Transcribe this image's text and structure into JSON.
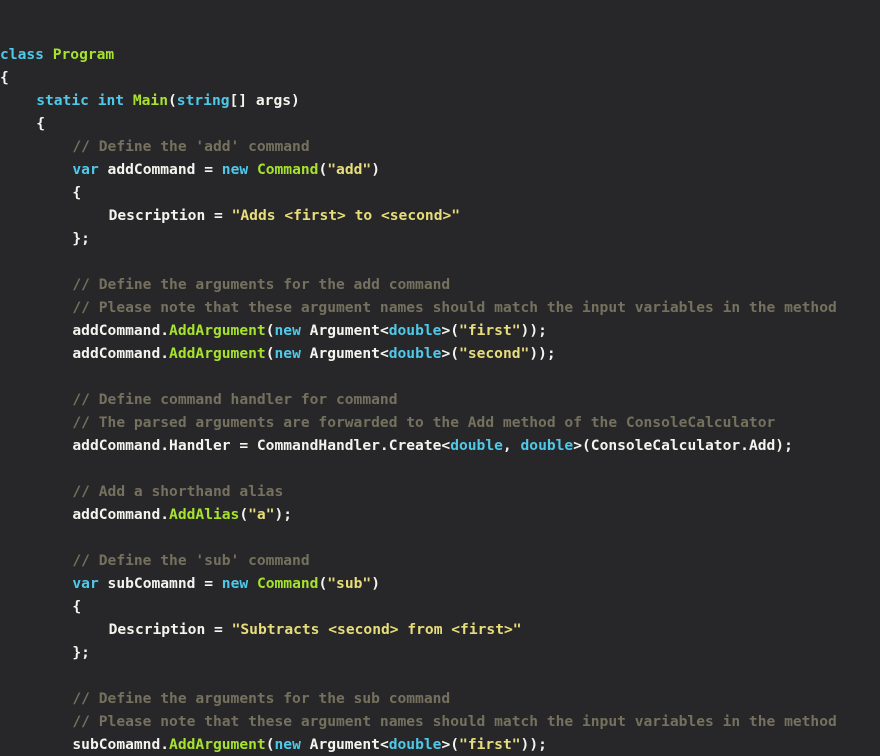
{
  "editor": {
    "language": "csharp",
    "background_color": "#272729",
    "theme_colors": {
      "plain": "#f4f4ef",
      "keyword": "#4fc9ea",
      "type": "#a6e22e",
      "string": "#e7dd7a",
      "comment": "#75715e"
    }
  },
  "code": {
    "lines": [
      {
        "id": 1,
        "indent": 0,
        "tokens": [
          {
            "t": "class ",
            "c": "kw"
          },
          {
            "t": "Program",
            "c": "typ"
          }
        ]
      },
      {
        "id": 2,
        "indent": 0,
        "tokens": [
          {
            "t": "{",
            "c": "pln"
          }
        ]
      },
      {
        "id": 3,
        "indent": 4,
        "tokens": [
          {
            "t": "static int ",
            "c": "kw"
          },
          {
            "t": "Main",
            "c": "typ"
          },
          {
            "t": "(",
            "c": "pln"
          },
          {
            "t": "string",
            "c": "kw"
          },
          {
            "t": "[] args)",
            "c": "pln"
          }
        ]
      },
      {
        "id": 4,
        "indent": 4,
        "tokens": [
          {
            "t": "{",
            "c": "pln"
          }
        ]
      },
      {
        "id": 5,
        "indent": 8,
        "tokens": [
          {
            "t": "// Define the 'add' command",
            "c": "cmt"
          }
        ]
      },
      {
        "id": 6,
        "indent": 8,
        "tokens": [
          {
            "t": "var ",
            "c": "kw"
          },
          {
            "t": "addCommand = ",
            "c": "pln"
          },
          {
            "t": "new ",
            "c": "kw"
          },
          {
            "t": "Command",
            "c": "typ"
          },
          {
            "t": "(",
            "c": "pln"
          },
          {
            "t": "\"add\"",
            "c": "str"
          },
          {
            "t": ")",
            "c": "pln"
          }
        ]
      },
      {
        "id": 7,
        "indent": 8,
        "tokens": [
          {
            "t": "{",
            "c": "pln"
          }
        ]
      },
      {
        "id": 8,
        "indent": 12,
        "tokens": [
          {
            "t": "Description = ",
            "c": "pln"
          },
          {
            "t": "\"Adds <first> to <second>\"",
            "c": "str"
          }
        ]
      },
      {
        "id": 9,
        "indent": 8,
        "tokens": [
          {
            "t": "};",
            "c": "pln"
          }
        ]
      },
      {
        "id": 10,
        "indent": 0,
        "tokens": []
      },
      {
        "id": 11,
        "indent": 8,
        "tokens": [
          {
            "t": "// Define the arguments for the add command",
            "c": "cmt"
          }
        ]
      },
      {
        "id": 12,
        "indent": 8,
        "tokens": [
          {
            "t": "// Please note that these argument names should match the input variables in the method",
            "c": "cmt"
          }
        ]
      },
      {
        "id": 13,
        "indent": 8,
        "tokens": [
          {
            "t": "addCommand.",
            "c": "pln"
          },
          {
            "t": "AddArgument",
            "c": "typ"
          },
          {
            "t": "(",
            "c": "pln"
          },
          {
            "t": "new ",
            "c": "kw"
          },
          {
            "t": "Argument<",
            "c": "pln"
          },
          {
            "t": "double",
            "c": "kw"
          },
          {
            "t": ">(",
            "c": "pln"
          },
          {
            "t": "\"first\"",
            "c": "str"
          },
          {
            "t": "));",
            "c": "pln"
          }
        ]
      },
      {
        "id": 14,
        "indent": 8,
        "tokens": [
          {
            "t": "addCommand.",
            "c": "pln"
          },
          {
            "t": "AddArgument",
            "c": "typ"
          },
          {
            "t": "(",
            "c": "pln"
          },
          {
            "t": "new ",
            "c": "kw"
          },
          {
            "t": "Argument<",
            "c": "pln"
          },
          {
            "t": "double",
            "c": "kw"
          },
          {
            "t": ">(",
            "c": "pln"
          },
          {
            "t": "\"second\"",
            "c": "str"
          },
          {
            "t": "));",
            "c": "pln"
          }
        ]
      },
      {
        "id": 15,
        "indent": 0,
        "tokens": []
      },
      {
        "id": 16,
        "indent": 8,
        "tokens": [
          {
            "t": "// Define command handler for command",
            "c": "cmt"
          }
        ]
      },
      {
        "id": 17,
        "indent": 8,
        "tokens": [
          {
            "t": "// The parsed arguments are forwarded to the Add method of the ConsoleCalculator",
            "c": "cmt"
          }
        ]
      },
      {
        "id": 18,
        "indent": 8,
        "tokens": [
          {
            "t": "addCommand.Handler = CommandHandler.Create<",
            "c": "pln"
          },
          {
            "t": "double",
            "c": "kw"
          },
          {
            "t": ", ",
            "c": "pln"
          },
          {
            "t": "double",
            "c": "kw"
          },
          {
            "t": ">(ConsoleCalculator.Add);",
            "c": "pln"
          }
        ]
      },
      {
        "id": 19,
        "indent": 0,
        "tokens": []
      },
      {
        "id": 20,
        "indent": 8,
        "tokens": [
          {
            "t": "// Add a shorthand alias",
            "c": "cmt"
          }
        ]
      },
      {
        "id": 21,
        "indent": 8,
        "tokens": [
          {
            "t": "addCommand.",
            "c": "pln"
          },
          {
            "t": "AddAlias",
            "c": "typ"
          },
          {
            "t": "(",
            "c": "pln"
          },
          {
            "t": "\"a\"",
            "c": "str"
          },
          {
            "t": ");",
            "c": "pln"
          }
        ]
      },
      {
        "id": 22,
        "indent": 0,
        "tokens": []
      },
      {
        "id": 23,
        "indent": 8,
        "tokens": [
          {
            "t": "// Define the 'sub' command",
            "c": "cmt"
          }
        ]
      },
      {
        "id": 24,
        "indent": 8,
        "tokens": [
          {
            "t": "var ",
            "c": "kw"
          },
          {
            "t": "subComamnd = ",
            "c": "pln"
          },
          {
            "t": "new ",
            "c": "kw"
          },
          {
            "t": "Command",
            "c": "typ"
          },
          {
            "t": "(",
            "c": "pln"
          },
          {
            "t": "\"sub\"",
            "c": "str"
          },
          {
            "t": ")",
            "c": "pln"
          }
        ]
      },
      {
        "id": 25,
        "indent": 8,
        "tokens": [
          {
            "t": "{",
            "c": "pln"
          }
        ]
      },
      {
        "id": 26,
        "indent": 12,
        "tokens": [
          {
            "t": "Description = ",
            "c": "pln"
          },
          {
            "t": "\"Subtracts <second> from <first>\"",
            "c": "str"
          }
        ]
      },
      {
        "id": 27,
        "indent": 8,
        "tokens": [
          {
            "t": "};",
            "c": "pln"
          }
        ]
      },
      {
        "id": 28,
        "indent": 0,
        "tokens": []
      },
      {
        "id": 29,
        "indent": 8,
        "tokens": [
          {
            "t": "// Define the arguments for the sub command",
            "c": "cmt"
          }
        ]
      },
      {
        "id": 30,
        "indent": 8,
        "tokens": [
          {
            "t": "// Please note that these argument names should match the input variables in the method",
            "c": "cmt"
          }
        ]
      },
      {
        "id": 31,
        "indent": 8,
        "tokens": [
          {
            "t": "subComamnd.",
            "c": "pln"
          },
          {
            "t": "AddArgument",
            "c": "typ"
          },
          {
            "t": "(",
            "c": "pln"
          },
          {
            "t": "new ",
            "c": "kw"
          },
          {
            "t": "Argument<",
            "c": "pln"
          },
          {
            "t": "double",
            "c": "kw"
          },
          {
            "t": ">(",
            "c": "pln"
          },
          {
            "t": "\"first\"",
            "c": "str"
          },
          {
            "t": "));",
            "c": "pln"
          }
        ]
      }
    ]
  }
}
